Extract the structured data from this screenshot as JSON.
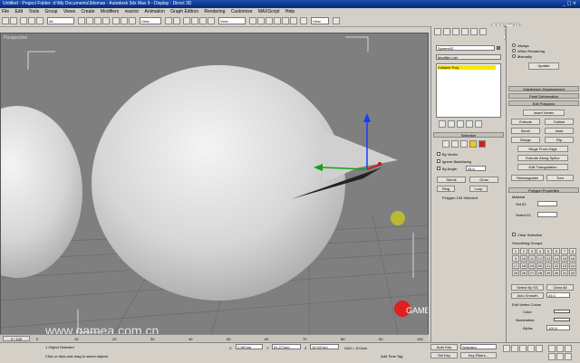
{
  "titlebar": {
    "title": "Untitled - Project Folder: d:\\My Documents\\3dsmax - Autodesk 3ds Max 9 - Display : Direct 3D",
    "controls": "_ □ ×"
  },
  "watermark_top": "优酷",
  "menu": [
    "File",
    "Edit",
    "Tools",
    "Group",
    "Views",
    "Create",
    "Modifiers",
    "reactor",
    "Animation",
    "Graph Editors",
    "Rendering",
    "Customize",
    "MAXScript",
    "Help"
  ],
  "toolbar": {
    "selection_filter": "All",
    "ref_coord": "View",
    "named_sel": "View"
  },
  "viewport": {
    "label": "Perspective",
    "colors": {
      "bg": "#808080",
      "sphere": "#d8d8d8",
      "grid": "#5a5a5a"
    }
  },
  "command_panel": {
    "object_name": "Sphere02",
    "modifier_list": "Modifier List",
    "stack_item": "Editable Poly",
    "selection_title": "Selection",
    "by_vertex": "By Vertex",
    "ignore_backfacing": "Ignore Backfacing",
    "by_angle": "By Angle:",
    "by_angle_val": "45.0",
    "shrink": "Shrink",
    "grow": "Grow",
    "ring": "Ring",
    "loop": "Loop",
    "selected_count": "Polygon 133 Selected"
  },
  "right_panel": {
    "update_opt1": "Always",
    "update_opt2": "When Rendering",
    "update_opt3": "Manually",
    "update": "Update",
    "subdiv_disp": "Subdivision Displacement",
    "paint_deform": "Paint Deformation",
    "edit_polygons": "Edit Polygons",
    "insert_vertex": "Insert Vertex",
    "extrude": "Extrude",
    "outline": "Outline",
    "bevel": "Bevel",
    "inset": "Inset",
    "bridge": "Bridge",
    "flip": "Flip",
    "hinge": "Hinge From Edge",
    "extrude_spline": "Extrude Along Spline",
    "edit_tri": "Edit Triangulation",
    "retriangulate": "Retriangulate",
    "turn": "Turn",
    "poly_props": "Polygon Properties",
    "material": "Material",
    "set_id": "Set ID:",
    "select_id": "Select ID:",
    "clear_selection": "Clear Selection",
    "smoothing_groups": "Smoothing Groups",
    "groups": [
      "1",
      "2",
      "3",
      "4",
      "5",
      "6",
      "7",
      "8",
      "9",
      "10",
      "11",
      "12",
      "13",
      "14",
      "15",
      "16",
      "17",
      "18",
      "19",
      "20",
      "21",
      "22",
      "23",
      "24",
      "25",
      "26",
      "27",
      "28",
      "29",
      "30",
      "31",
      "32"
    ],
    "select_by_sg": "Select By SG",
    "clear_all": "Clear All",
    "auto_smooth": "Auto Smooth",
    "auto_val": "45.0",
    "edit_vertex_colors": "Edit Vertex Colors",
    "color": "Color:",
    "illumination": "Illumination:",
    "alpha": "Alpha:",
    "alpha_val": "100.0"
  },
  "timeline": {
    "frame": "0 / 100",
    "ticks": [
      "0",
      "10",
      "20",
      "30",
      "40",
      "50",
      "60",
      "70",
      "80",
      "90",
      "100"
    ]
  },
  "status": {
    "objects_selected": "1 Object Selected",
    "prompt": "Click or click-and-drag to select objects",
    "x": "2.967cm",
    "y": "51.271cm",
    "z": "19.937cm",
    "grid": "Grid = 10.0cm",
    "auto_key": "Auto Key",
    "set_key": "Set Key",
    "selected": "Selected",
    "key_filters": "Key Filters...",
    "add_time_tag": "Add Time Tag"
  },
  "watermark_bottom": "www.gamea.com.cn",
  "logo_text": "GAME"
}
